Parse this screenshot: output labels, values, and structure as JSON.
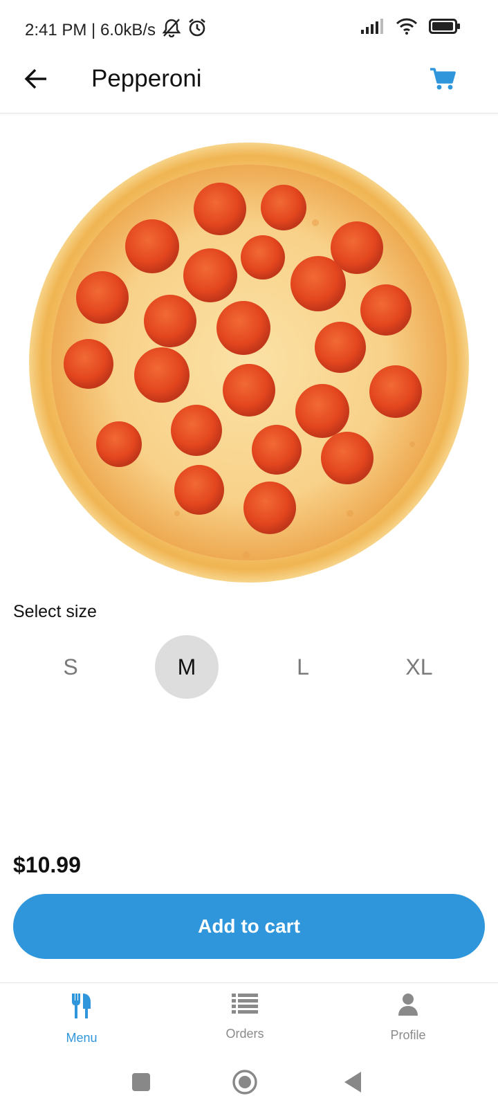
{
  "status_bar": {
    "time": "2:41 PM | 6.0kB/s"
  },
  "app_bar": {
    "title": "Pepperoni",
    "back_icon": "arrow-left-icon",
    "cart_icon": "cart-icon"
  },
  "colors": {
    "accent": "#3096dc",
    "selected_bg": "#dddddd",
    "muted_text": "#8a8a8a"
  },
  "size_selector": {
    "label": "Select size",
    "options": [
      "S",
      "M",
      "L",
      "XL"
    ],
    "selected": "M"
  },
  "price": "$10.99",
  "cta": {
    "label": "Add to cart"
  },
  "bottom_nav": {
    "items": [
      {
        "label": "Menu",
        "icon": "utensils-icon",
        "active": true
      },
      {
        "label": "Orders",
        "icon": "list-icon",
        "active": false
      },
      {
        "label": "Profile",
        "icon": "user-icon",
        "active": false
      }
    ]
  },
  "system_nav": {
    "icons": [
      "square-icon",
      "circle-icon",
      "triangle-back-icon"
    ]
  }
}
